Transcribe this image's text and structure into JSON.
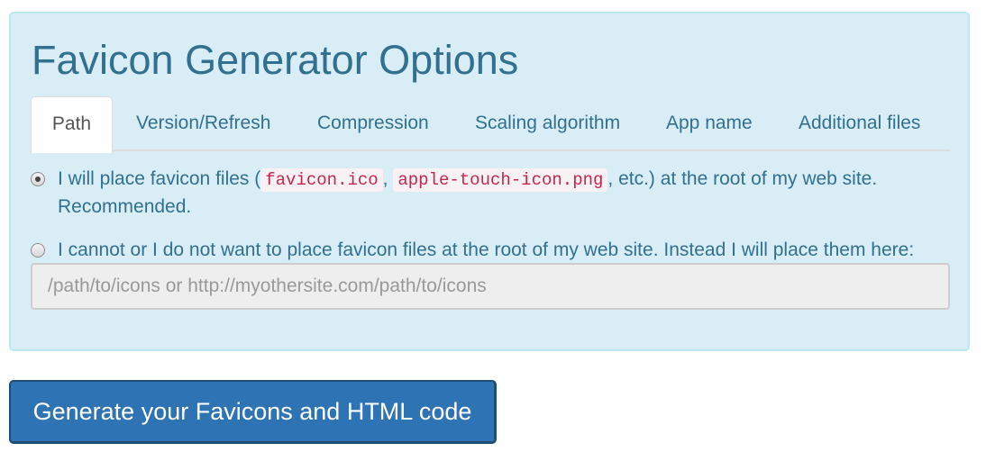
{
  "panel": {
    "title": "Favicon Generator Options"
  },
  "tabs": [
    {
      "label": "Path",
      "active": true
    },
    {
      "label": "Version/Refresh",
      "active": false
    },
    {
      "label": "Compression",
      "active": false
    },
    {
      "label": "Scaling algorithm",
      "active": false
    },
    {
      "label": "App name",
      "active": false
    },
    {
      "label": "Additional files",
      "active": false
    }
  ],
  "options": {
    "root": {
      "checked": true,
      "text_before": "I will place favicon files (",
      "code1": "favicon.ico",
      "separator": ",",
      "code2": "apple-touch-icon.png",
      "text_after": ", etc.) at the root of my web site.",
      "note": "Recommended."
    },
    "custom": {
      "checked": false,
      "text": "I cannot or I do not want to place favicon files at the root of my web site. Instead I will place them here:",
      "input_value": "",
      "input_placeholder": "/path/to/icons or http://myothersite.com/path/to/icons"
    }
  },
  "generate_button": {
    "label": "Generate your Favicons and HTML code"
  },
  "colors": {
    "panel_background": "#d9edf7",
    "panel_border": "#bce8f1",
    "text": "#31708f",
    "code_text": "#c7254e",
    "button_background": "#2e73b3"
  }
}
